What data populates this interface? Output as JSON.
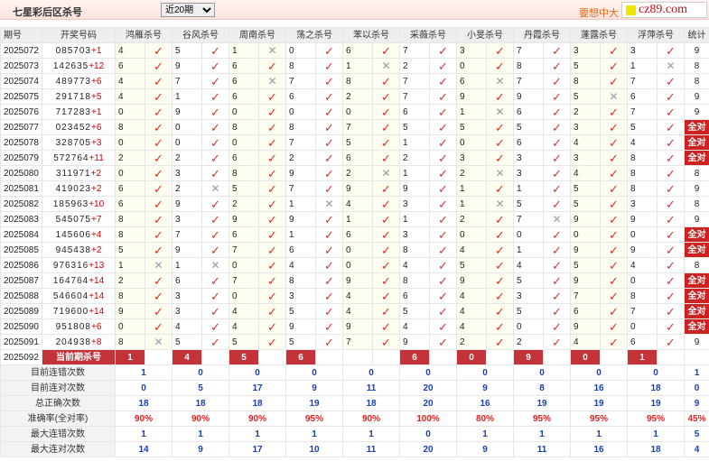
{
  "header": {
    "title": "七星彩后区杀号",
    "select_value": "近20期",
    "link_text": "要想中大",
    "watermark": "cz89.com"
  },
  "columns": [
    "期号",
    "开奖号码",
    "鸿雁杀号",
    "谷风杀号",
    "周南杀号",
    "荡之杀号",
    "苯以杀号",
    "采薇杀号",
    "小旻杀号",
    "丹霞杀号",
    "蓬露杀号",
    "浮萍杀号",
    "统计"
  ],
  "rows": [
    {
      "p": "2025072",
      "d": "085703",
      "s": "+1",
      "k": [
        [
          4,
          1
        ],
        [
          5,
          1
        ],
        [
          1,
          0
        ],
        [
          0,
          1
        ],
        [
          6,
          1
        ],
        [
          7,
          1
        ],
        [
          3,
          1
        ],
        [
          7,
          1
        ],
        [
          3,
          1
        ],
        [
          3,
          1
        ]
      ],
      "t": "9"
    },
    {
      "p": "2025073",
      "d": "142635",
      "s": "+12",
      "k": [
        [
          6,
          1
        ],
        [
          9,
          1
        ],
        [
          6,
          1
        ],
        [
          8,
          1
        ],
        [
          1,
          0
        ],
        [
          2,
          1
        ],
        [
          0,
          1
        ],
        [
          8,
          1
        ],
        [
          5,
          1
        ],
        [
          1,
          0
        ]
      ],
      "t": "8"
    },
    {
      "p": "2025074",
      "d": "489773",
      "s": "+6",
      "k": [
        [
          4,
          1
        ],
        [
          7,
          1
        ],
        [
          6,
          0
        ],
        [
          7,
          1
        ],
        [
          8,
          1
        ],
        [
          7,
          1
        ],
        [
          6,
          0
        ],
        [
          7,
          1
        ],
        [
          8,
          1
        ],
        [
          7,
          1
        ]
      ],
      "t": "8"
    },
    {
      "p": "2025075",
      "d": "291718",
      "s": "+5",
      "k": [
        [
          4,
          1
        ],
        [
          1,
          1
        ],
        [
          6,
          1
        ],
        [
          6,
          1
        ],
        [
          2,
          1
        ],
        [
          7,
          1
        ],
        [
          9,
          1
        ],
        [
          9,
          1
        ],
        [
          5,
          0
        ],
        [
          6,
          1
        ]
      ],
      "t": "9"
    },
    {
      "p": "2025076",
      "d": "717283",
      "s": "+1",
      "k": [
        [
          0,
          1
        ],
        [
          9,
          1
        ],
        [
          0,
          1
        ],
        [
          0,
          1
        ],
        [
          0,
          1
        ],
        [
          6,
          1
        ],
        [
          1,
          0
        ],
        [
          6,
          1
        ],
        [
          2,
          1
        ],
        [
          7,
          1
        ]
      ],
      "t": "9"
    },
    {
      "p": "2025077",
      "d": "023452",
      "s": "+6",
      "k": [
        [
          8,
          1
        ],
        [
          0,
          1
        ],
        [
          8,
          1
        ],
        [
          8,
          1
        ],
        [
          7,
          1
        ],
        [
          5,
          1
        ],
        [
          5,
          1
        ],
        [
          5,
          1
        ],
        [
          3,
          1
        ],
        [
          5,
          1
        ]
      ],
      "t": "全对"
    },
    {
      "p": "2025078",
      "d": "328705",
      "s": "+3",
      "k": [
        [
          0,
          1
        ],
        [
          0,
          1
        ],
        [
          0,
          1
        ],
        [
          7,
          1
        ],
        [
          5,
          1
        ],
        [
          1,
          1
        ],
        [
          0,
          1
        ],
        [
          6,
          1
        ],
        [
          4,
          1
        ],
        [
          4,
          1
        ]
      ],
      "t": "全对"
    },
    {
      "p": "2025079",
      "d": "572764",
      "s": "+11",
      "k": [
        [
          2,
          1
        ],
        [
          2,
          1
        ],
        [
          6,
          1
        ],
        [
          2,
          1
        ],
        [
          6,
          1
        ],
        [
          2,
          1
        ],
        [
          3,
          1
        ],
        [
          3,
          1
        ],
        [
          3,
          1
        ],
        [
          8,
          1
        ]
      ],
      "t": "全对"
    },
    {
      "p": "2025080",
      "d": "311971",
      "s": "+2",
      "k": [
        [
          0,
          1
        ],
        [
          3,
          1
        ],
        [
          8,
          1
        ],
        [
          9,
          1
        ],
        [
          2,
          0
        ],
        [
          1,
          1
        ],
        [
          2,
          0
        ],
        [
          3,
          1
        ],
        [
          4,
          1
        ],
        [
          8,
          1
        ]
      ],
      "t": "8"
    },
    {
      "p": "2025081",
      "d": "419023",
      "s": "+2",
      "k": [
        [
          6,
          1
        ],
        [
          2,
          0
        ],
        [
          5,
          1
        ],
        [
          7,
          1
        ],
        [
          9,
          1
        ],
        [
          9,
          1
        ],
        [
          1,
          1
        ],
        [
          1,
          1
        ],
        [
          5,
          1
        ],
        [
          8,
          1
        ]
      ],
      "t": "9"
    },
    {
      "p": "2025082",
      "d": "185963",
      "s": "+10",
      "k": [
        [
          6,
          1
        ],
        [
          9,
          1
        ],
        [
          2,
          1
        ],
        [
          1,
          0
        ],
        [
          4,
          1
        ],
        [
          3,
          1
        ],
        [
          1,
          0
        ],
        [
          5,
          1
        ],
        [
          5,
          1
        ],
        [
          3,
          1
        ]
      ],
      "t": "8"
    },
    {
      "p": "2025083",
      "d": "545075",
      "s": "+7",
      "k": [
        [
          8,
          1
        ],
        [
          3,
          1
        ],
        [
          9,
          1
        ],
        [
          9,
          1
        ],
        [
          1,
          1
        ],
        [
          1,
          1
        ],
        [
          2,
          1
        ],
        [
          7,
          0
        ],
        [
          9,
          1
        ],
        [
          9,
          1
        ]
      ],
      "t": "9"
    },
    {
      "p": "2025084",
      "d": "145606",
      "s": "+4",
      "k": [
        [
          8,
          1
        ],
        [
          7,
          1
        ],
        [
          6,
          1
        ],
        [
          1,
          1
        ],
        [
          6,
          1
        ],
        [
          3,
          1
        ],
        [
          0,
          1
        ],
        [
          0,
          1
        ],
        [
          0,
          1
        ],
        [
          0,
          1
        ]
      ],
      "t": "全对"
    },
    {
      "p": "2025085",
      "d": "945438",
      "s": "+2",
      "k": [
        [
          5,
          1
        ],
        [
          9,
          1
        ],
        [
          7,
          1
        ],
        [
          6,
          1
        ],
        [
          0,
          1
        ],
        [
          8,
          1
        ],
        [
          4,
          1
        ],
        [
          1,
          1
        ],
        [
          9,
          1
        ],
        [
          9,
          1
        ]
      ],
      "t": "全对"
    },
    {
      "p": "2025086",
      "d": "976316",
      "s": "+13",
      "k": [
        [
          1,
          0
        ],
        [
          1,
          0
        ],
        [
          0,
          1
        ],
        [
          4,
          1
        ],
        [
          0,
          1
        ],
        [
          4,
          1
        ],
        [
          5,
          1
        ],
        [
          4,
          1
        ],
        [
          5,
          1
        ],
        [
          4,
          1
        ]
      ],
      "t": "8"
    },
    {
      "p": "2025087",
      "d": "164764",
      "s": "+14",
      "k": [
        [
          2,
          1
        ],
        [
          6,
          1
        ],
        [
          7,
          1
        ],
        [
          8,
          1
        ],
        [
          9,
          1
        ],
        [
          8,
          1
        ],
        [
          9,
          1
        ],
        [
          5,
          1
        ],
        [
          9,
          1
        ],
        [
          0,
          1
        ]
      ],
      "t": "全对"
    },
    {
      "p": "2025088",
      "d": "546604",
      "s": "+14",
      "k": [
        [
          8,
          1
        ],
        [
          3,
          1
        ],
        [
          0,
          1
        ],
        [
          3,
          1
        ],
        [
          4,
          1
        ],
        [
          6,
          1
        ],
        [
          4,
          1
        ],
        [
          3,
          1
        ],
        [
          7,
          1
        ],
        [
          8,
          1
        ]
      ],
      "t": "全对"
    },
    {
      "p": "2025089",
      "d": "719600",
      "s": "+14",
      "k": [
        [
          9,
          1
        ],
        [
          3,
          1
        ],
        [
          4,
          1
        ],
        [
          5,
          1
        ],
        [
          4,
          1
        ],
        [
          5,
          1
        ],
        [
          4,
          1
        ],
        [
          5,
          1
        ],
        [
          6,
          1
        ],
        [
          7,
          1
        ]
      ],
      "t": "全对"
    },
    {
      "p": "2025090",
      "d": "951808",
      "s": "+6",
      "k": [
        [
          0,
          1
        ],
        [
          4,
          1
        ],
        [
          4,
          1
        ],
        [
          9,
          1
        ],
        [
          9,
          1
        ],
        [
          4,
          1
        ],
        [
          4,
          1
        ],
        [
          0,
          1
        ],
        [
          9,
          1
        ],
        [
          0,
          1
        ]
      ],
      "t": "全对"
    },
    {
      "p": "2025091",
      "d": "204938",
      "s": "+8",
      "k": [
        [
          8,
          0
        ],
        [
          5,
          1
        ],
        [
          5,
          1
        ],
        [
          5,
          1
        ],
        [
          7,
          1
        ],
        [
          9,
          1
        ],
        [
          2,
          1
        ],
        [
          2,
          1
        ],
        [
          4,
          1
        ],
        [
          6,
          1
        ]
      ],
      "t": "9"
    }
  ],
  "current": {
    "period": "2025092",
    "label": "当前期杀号",
    "kills": [
      "1",
      "4",
      "5",
      "6",
      "",
      "6",
      "0",
      "9",
      "0",
      "1"
    ]
  },
  "stats": [
    {
      "label": "目前连错次数",
      "values": [
        "1",
        "0",
        "0",
        "0",
        "0",
        "0",
        "0",
        "0",
        "0",
        "0",
        "1"
      ]
    },
    {
      "label": "目前连对次数",
      "values": [
        "0",
        "5",
        "17",
        "9",
        "11",
        "20",
        "9",
        "8",
        "16",
        "18",
        "0"
      ]
    },
    {
      "label": "总正确次数",
      "values": [
        "18",
        "18",
        "18",
        "19",
        "18",
        "20",
        "16",
        "19",
        "19",
        "19",
        "9"
      ]
    },
    {
      "label": "准确率(全对率)",
      "values": [
        "90%",
        "90%",
        "90%",
        "95%",
        "90%",
        "100%",
        "80%",
        "95%",
        "95%",
        "95%",
        "45%"
      ],
      "red": true
    },
    {
      "label": "最大连错次数",
      "values": [
        "1",
        "1",
        "1",
        "1",
        "1",
        "0",
        "1",
        "1",
        "1",
        "1",
        "5"
      ]
    },
    {
      "label": "最大连对次数",
      "values": [
        "14",
        "9",
        "17",
        "10",
        "11",
        "20",
        "9",
        "11",
        "16",
        "18",
        "4"
      ]
    }
  ],
  "symbols": {
    "ok": "✓",
    "bad": "✕"
  }
}
